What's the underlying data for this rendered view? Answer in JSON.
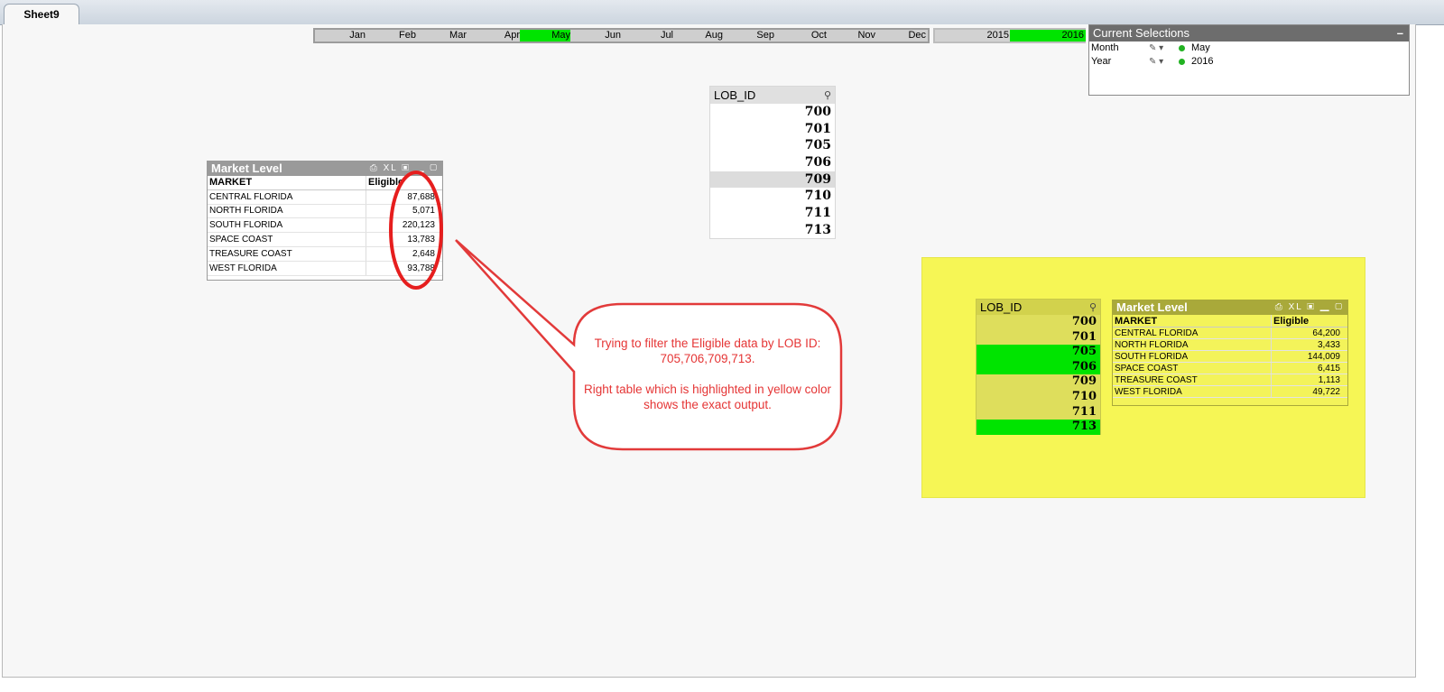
{
  "tabs": [
    {
      "label": "Sheet9"
    }
  ],
  "month_filter": {
    "months": [
      "Jan",
      "Feb",
      "Mar",
      "Apr",
      "May",
      "Jun",
      "Jul",
      "Aug",
      "Sep",
      "Oct",
      "Nov",
      "Dec"
    ],
    "selected": "May"
  },
  "year_filter": {
    "years": [
      "2015",
      "2016"
    ],
    "selected": "2016"
  },
  "current_selections": {
    "title": "Current Selections",
    "minimize": "–",
    "rows": [
      {
        "field": "Month",
        "value": "May"
      },
      {
        "field": "Year",
        "value": "2016"
      }
    ]
  },
  "lob_top": {
    "title": "LOB_ID",
    "items": [
      "700",
      "701",
      "705",
      "706",
      "709",
      "710",
      "711",
      "713"
    ],
    "highlighted": [
      "709"
    ]
  },
  "market_left": {
    "title": "Market Level",
    "icons": "⎙ XL ▣ ▁ ▢",
    "col_market": "MARKET",
    "col_eligible": "Eligible",
    "rows": [
      {
        "market": "CENTRAL FLORIDA",
        "eligible": "87,688"
      },
      {
        "market": "NORTH FLORIDA",
        "eligible": "5,071"
      },
      {
        "market": "SOUTH FLORIDA",
        "eligible": "220,123"
      },
      {
        "market": "SPACE COAST",
        "eligible": "13,783"
      },
      {
        "market": "TREASURE COAST",
        "eligible": "2,648"
      },
      {
        "market": "WEST FLORIDA",
        "eligible": "93,788"
      }
    ]
  },
  "callout": {
    "line1": "Trying to filter the Eligible data by LOB ID: 705,706,709,713.",
    "line2": "Right table which is highlighted in yellow color shows the exact output."
  },
  "lob_right": {
    "title": "LOB_ID",
    "items": [
      "700",
      "701",
      "705",
      "706",
      "709",
      "710",
      "711",
      "713"
    ],
    "selected": [
      "705",
      "706",
      "713"
    ]
  },
  "market_right": {
    "title": "Market Level",
    "icons": "⎙ XL ▣ ▁ ▢",
    "col_market": "MARKET",
    "col_eligible": "Eligible",
    "rows": [
      {
        "market": "CENTRAL FLORIDA",
        "eligible": "64,200"
      },
      {
        "market": "NORTH FLORIDA",
        "eligible": "3,433"
      },
      {
        "market": "SOUTH FLORIDA",
        "eligible": "144,009"
      },
      {
        "market": "SPACE COAST",
        "eligible": "6,415"
      },
      {
        "market": "TREASURE COAST",
        "eligible": "1,113"
      },
      {
        "market": "WEST FLORIDA",
        "eligible": "49,722"
      }
    ]
  },
  "colors": {
    "selected_green": "#00e400",
    "highlight_yellow": "#f6f655",
    "callout_red": "#e53535"
  }
}
